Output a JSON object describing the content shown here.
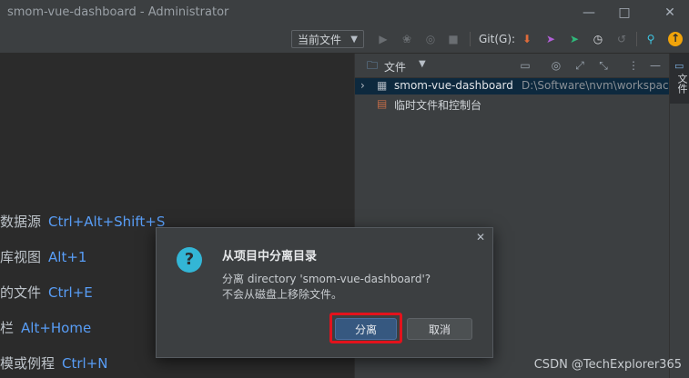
{
  "window": {
    "title": "smom-vue-dashboard - Administrator",
    "min_icon": "minimize-icon",
    "max_icon": "maximize-icon",
    "close_icon": "close-icon"
  },
  "toolbar": {
    "combo_label": "当前文件",
    "git_label": "Git(G):",
    "icons": [
      "run-icon",
      "debug-icon",
      "coverage-icon",
      "stop-icon",
      "git-update-icon",
      "git-push-icon",
      "git-commit-icon",
      "history-icon",
      "rollback-icon",
      "search-icon",
      "update-available-icon"
    ]
  },
  "editor": {
    "tips": [
      {
        "label": "数据源",
        "shortcut": "Ctrl+Alt+Shift+S"
      },
      {
        "label": "库视图",
        "shortcut": "Alt+1"
      },
      {
        "label": "的文件",
        "shortcut": "Ctrl+E"
      },
      {
        "label": "栏",
        "shortcut": "Alt+Home"
      },
      {
        "label": "模或例程",
        "shortcut": "Ctrl+N"
      }
    ]
  },
  "project_panel": {
    "header_label": "文件",
    "tree": [
      {
        "name": "smom-vue-dashboard",
        "path": "D:\\Software\\nvm\\workspace"
      },
      {
        "name": "临时文件和控制台"
      }
    ]
  },
  "side_strip": {
    "label": "文件"
  },
  "dialog": {
    "title": "从项目中分离目录",
    "message_line1": "分离 directory 'smom-vue-dashboard'?",
    "message_line2": "不会从磁盘上移除文件。",
    "primary_button": "分离",
    "secondary_button": "取消"
  },
  "watermark": "CSDN @TechExplorer365",
  "colors": {
    "accent_blue": "#589df6",
    "selection_blue": "#0d293e",
    "dialog_question": "#33b6d6",
    "highlight_red": "#e3121c",
    "git_update": "#e06b3a",
    "git_push": "#b15fd6",
    "git_commit": "#2fb87a",
    "update_badge": "#f0a30a"
  }
}
